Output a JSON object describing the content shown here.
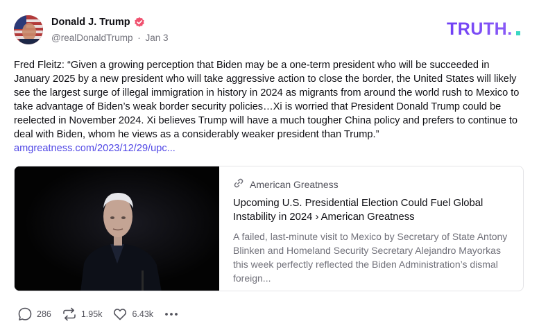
{
  "author": {
    "display_name": "Donald J. Trump",
    "handle": "@realDonaldTrump",
    "separator": "·",
    "date": "Jan 3",
    "verified_color": "#f0506e"
  },
  "brand": {
    "logo_text": "TRUTH.",
    "gradient": [
      "#6f3ff5",
      "#8b5cf6"
    ],
    "dot_color": "#3ad7c3"
  },
  "post": {
    "text": "Fred Fleitz: “Given a growing perception that Biden may be a one-term president who will be succeeded in January 2025 by a new president who will take aggressive action to close the border, the United States will likely see the largest surge of illegal immigration in history in 2024 as migrants from around the world rush to Mexico to take advantage of Biden’s weak border security policies…Xi is worried that President Donald Trump could be reelected in November 2024. Xi believes Trump will have a much tougher China policy and prefers to continue to deal with Biden, whom he views as a considerably weaker president than Trump.” ",
    "link_text": "amgreatness.com/2023/12/29/upc...",
    "link_color": "#4f46e5"
  },
  "link_card": {
    "icon": "link-icon",
    "source": "American Greatness",
    "title": "Upcoming U.S. Presidential Election Could Fuel Global Instability in 2024 › American Greatness",
    "description": "A failed, last-minute visit to Mexico by Secretary of State Antony Blinken and Homeland Security Secretary Alejandro Mayorkas this week perfectly reflected the Biden Administration’s dismal foreign..."
  },
  "actions": {
    "replies": {
      "icon": "reply-icon",
      "count": "286"
    },
    "retruths": {
      "icon": "retruth-icon",
      "count": "1.95k"
    },
    "likes": {
      "icon": "heart-icon",
      "count": "6.43k"
    },
    "more": {
      "icon": "more-icon"
    }
  }
}
